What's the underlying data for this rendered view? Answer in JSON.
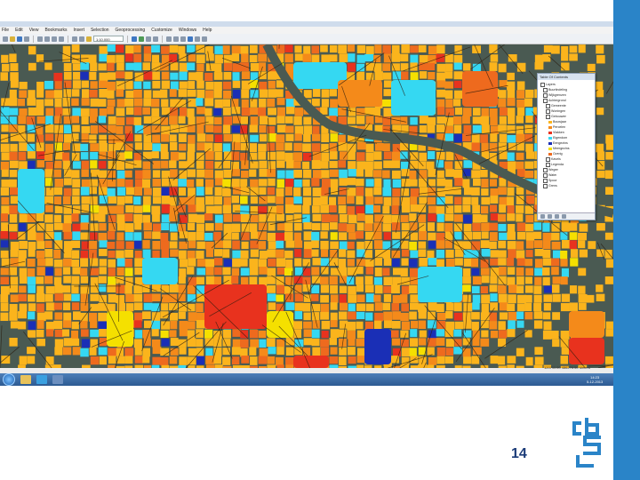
{
  "slide": {
    "page_number": "14",
    "accent_color": "#2a84c8",
    "title_color": "#1b3b78"
  },
  "app": {
    "menu": [
      "File",
      "Edit",
      "View",
      "Bookmarks",
      "Insert",
      "Selection",
      "Geoprocessing",
      "Customize",
      "Windows",
      "Help"
    ],
    "scale": "1:10.000",
    "status_coordinates": "120711.00 486276.50 Meters",
    "toc": {
      "title": "Table Of Contents",
      "items": [
        "Layers",
        "Buurtindeling",
        "Wijkgrenzen",
        "Achtergrond",
        "Gemeente",
        "Woningen",
        "Gebouwen",
        "Bouwjaar",
        "Percelen",
        "Vlakken",
        "Eigendom",
        "Eengezins",
        "Meergezins",
        "Overig",
        "Kavels",
        "Legenda",
        "Wegen",
        "Water",
        "Spoor",
        "Grens"
      ]
    },
    "taskbar": {
      "clock_time": "14:23",
      "clock_date": "5-12-2013"
    }
  },
  "map": {
    "colors": {
      "light_orange": "#fbb41c",
      "orange": "#f48a1a",
      "dark_orange": "#ee6a1e",
      "red": "#e8321e",
      "cyan": "#35d8f2",
      "blue": "#1a2fb6",
      "yellow": "#f5e000",
      "water": "#4a5a52",
      "street": "#2a1c0e"
    }
  }
}
